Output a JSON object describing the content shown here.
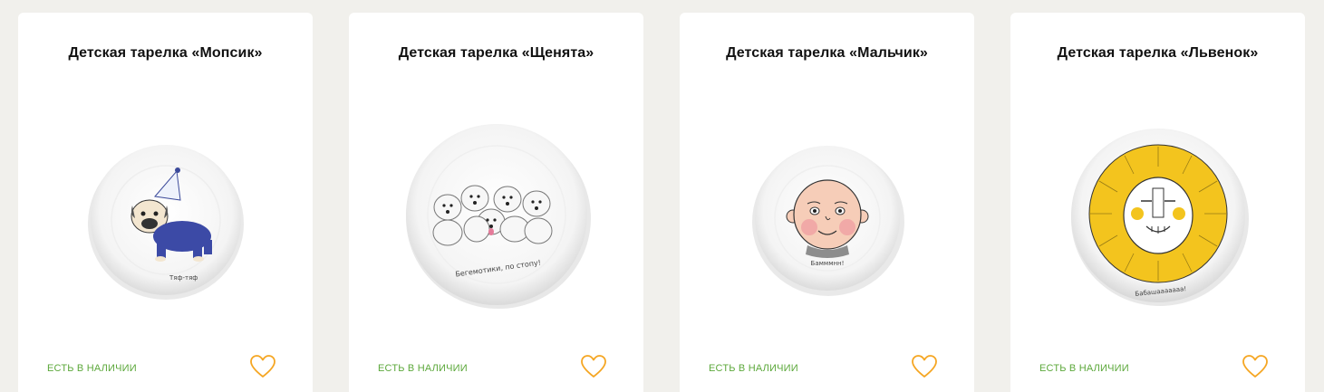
{
  "products": [
    {
      "title": "Детская тарелка «Мопсик»",
      "stock": "ЕСТЬ В НАЛИЧИИ",
      "plate_caption": "Тяф-тяф",
      "plate_icon": "pug-plate-icon"
    },
    {
      "title": "Детская тарелка «Щенята»",
      "stock": "ЕСТЬ В НАЛИЧИИ",
      "plate_caption": "Бегемотики, по стопу!",
      "plate_icon": "puppies-plate-icon"
    },
    {
      "title": "Детская тарелка «Мальчик»",
      "stock": "ЕСТЬ В НАЛИЧИИ",
      "plate_caption": "Бамммнн!",
      "plate_icon": "boy-plate-icon"
    },
    {
      "title": "Детская тарелка «Львенок»",
      "stock": "ЕСТЬ В НАЛИЧИИ",
      "plate_caption": "Бабашааааааа!",
      "plate_icon": "lion-plate-icon"
    }
  ],
  "colors": {
    "page_bg": "#f1f0ec",
    "stock_green": "#5ca83b",
    "heart_orange": "#f5a623"
  },
  "favorite_icon": "heart-outline-icon"
}
